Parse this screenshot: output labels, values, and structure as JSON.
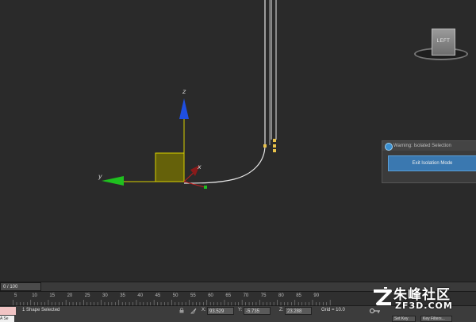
{
  "viewport": {
    "viewcube_label": "LEFT",
    "axis_z": "z",
    "axis_y": "y",
    "axis_x": "x"
  },
  "warning_dialog": {
    "title": "Warning: Isolated Selection",
    "button": "Exit Isolation Mode"
  },
  "time_slider": {
    "frame_counter": "0 / 100"
  },
  "track_ruler": {
    "ticks": [
      "5",
      "10",
      "15",
      "20",
      "25",
      "30",
      "35",
      "40",
      "45",
      "50",
      "55",
      "60",
      "65",
      "70",
      "75",
      "80",
      "85",
      "90"
    ]
  },
  "status_bar": {
    "selection_text": "1 Shape Selected",
    "x_label": "X:",
    "x_value": "93.529",
    "y_label": "Y:",
    "y_value": "-5.735",
    "z_label": "Z:",
    "z_value": "23.288",
    "grid": "Grid = 10.0",
    "corner_label": "A Se",
    "set_key": "Set Key",
    "key_filters": "Key Filters..."
  },
  "watermark": {
    "main": "朱峰社区",
    "sub": "ZF3D.COM"
  },
  "colors": {
    "axis_z": "#1f4fe0",
    "axis_y": "#1fc01f",
    "axis_x": "#c01f1f",
    "spline": "#e8e8e8",
    "gizmo_plane": "#d8d000",
    "dialog_button": "#3a78b0"
  }
}
